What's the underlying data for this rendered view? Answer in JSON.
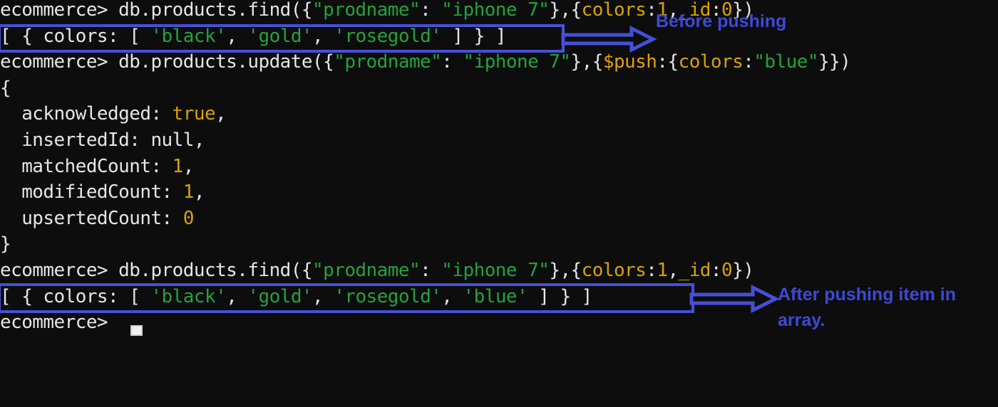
{
  "terminal": {
    "background_color": "#0d0d0d",
    "prompt": "ecommerce>",
    "lines": [
      {
        "id": "line-find-before",
        "segments": [
          {
            "text": "ecommerce> db.products.find(",
            "color": "white"
          },
          {
            "text": "{",
            "color": "white"
          },
          {
            "text": "\"prodname\"",
            "color": "green"
          },
          {
            "text": ": ",
            "color": "white"
          },
          {
            "text": "\"iphone 7\"",
            "color": "green"
          },
          {
            "text": "},{",
            "color": "white"
          },
          {
            "text": "colors",
            "color": "yellow"
          },
          {
            "text": ":",
            "color": "white"
          },
          {
            "text": "1",
            "color": "yellow"
          },
          {
            "text": ",",
            "color": "white"
          },
          {
            "text": "_id",
            "color": "yellow"
          },
          {
            "text": ":",
            "color": "white"
          },
          {
            "text": "0",
            "color": "yellow"
          },
          {
            "text": "})",
            "color": "white"
          }
        ]
      },
      {
        "id": "line-result-before",
        "segments": [
          {
            "text": "[ { colors: [ ",
            "color": "white"
          },
          {
            "text": "'black'",
            "color": "green"
          },
          {
            "text": ", ",
            "color": "white"
          },
          {
            "text": "'gold'",
            "color": "green"
          },
          {
            "text": ", ",
            "color": "white"
          },
          {
            "text": "'rosegold'",
            "color": "green"
          },
          {
            "text": " ] } ]",
            "color": "white"
          }
        ]
      },
      {
        "id": "line-update",
        "segments": [
          {
            "text": "ecommerce> db.products.update(",
            "color": "white"
          },
          {
            "text": "{",
            "color": "white"
          },
          {
            "text": "\"prodname\"",
            "color": "green"
          },
          {
            "text": ": ",
            "color": "white"
          },
          {
            "text": "\"iphone 7\"",
            "color": "green"
          },
          {
            "text": "},{",
            "color": "white"
          },
          {
            "text": "$push",
            "color": "orange"
          },
          {
            "text": ":{",
            "color": "white"
          },
          {
            "text": "colors",
            "color": "yellow"
          },
          {
            "text": ":",
            "color": "white"
          },
          {
            "text": "\"blue\"",
            "color": "green"
          },
          {
            "text": "}})",
            "color": "white"
          }
        ]
      },
      {
        "id": "line-open-brace",
        "segments": [
          {
            "text": "{",
            "color": "white"
          }
        ]
      },
      {
        "id": "line-acknowledged",
        "segments": [
          {
            "text": "  acknowledged: ",
            "color": "white"
          },
          {
            "text": "true",
            "color": "yellow"
          },
          {
            "text": ",",
            "color": "white"
          }
        ]
      },
      {
        "id": "line-insertedid",
        "segments": [
          {
            "text": "  insertedId: null,",
            "color": "white"
          }
        ]
      },
      {
        "id": "line-matchedcount",
        "segments": [
          {
            "text": "  matchedCount: ",
            "color": "white"
          },
          {
            "text": "1",
            "color": "yellow"
          },
          {
            "text": ",",
            "color": "white"
          }
        ]
      },
      {
        "id": "line-modifiedcount",
        "segments": [
          {
            "text": "  modifiedCount: ",
            "color": "white"
          },
          {
            "text": "1",
            "color": "yellow"
          },
          {
            "text": ",",
            "color": "white"
          }
        ]
      },
      {
        "id": "line-upsertedcount",
        "segments": [
          {
            "text": "  upsertedCount: ",
            "color": "white"
          },
          {
            "text": "0",
            "color": "yellow"
          }
        ]
      },
      {
        "id": "line-close-brace",
        "segments": [
          {
            "text": "}",
            "color": "white"
          }
        ]
      },
      {
        "id": "line-find-after",
        "segments": [
          {
            "text": "ecommerce> db.products.find(",
            "color": "white"
          },
          {
            "text": "{",
            "color": "white"
          },
          {
            "text": "\"prodname\"",
            "color": "green"
          },
          {
            "text": ": ",
            "color": "white"
          },
          {
            "text": "\"iphone 7\"",
            "color": "green"
          },
          {
            "text": "},{",
            "color": "white"
          },
          {
            "text": "colors",
            "color": "yellow"
          },
          {
            "text": ":",
            "color": "white"
          },
          {
            "text": "1",
            "color": "yellow"
          },
          {
            "text": ",",
            "color": "white"
          },
          {
            "text": "_id",
            "color": "yellow"
          },
          {
            "text": ":",
            "color": "white"
          },
          {
            "text": "0",
            "color": "yellow"
          },
          {
            "text": "})",
            "color": "white"
          }
        ]
      },
      {
        "id": "line-result-after",
        "segments": [
          {
            "text": "[ { colors: [ ",
            "color": "white"
          },
          {
            "text": "'black'",
            "color": "green"
          },
          {
            "text": ", ",
            "color": "white"
          },
          {
            "text": "'gold'",
            "color": "green"
          },
          {
            "text": ", ",
            "color": "white"
          },
          {
            "text": "'rosegold'",
            "color": "green"
          },
          {
            "text": ", ",
            "color": "white"
          },
          {
            "text": "'blue'",
            "color": "green"
          },
          {
            "text": " ] } ]",
            "color": "white"
          }
        ]
      },
      {
        "id": "line-prompt-final",
        "segments": [
          {
            "text": "ecommerce> ",
            "color": "white"
          }
        ]
      }
    ]
  },
  "annotations": {
    "accent_color": "#4550d8",
    "items": [
      {
        "id": "before-pushing",
        "label": "Before pushing",
        "icon": "right-arrow-icon"
      },
      {
        "id": "after-pushing",
        "label": "After pushing item in\narray.",
        "icon": "right-arrow-icon"
      }
    ]
  },
  "query_data": {
    "database": "ecommerce",
    "collection": "products",
    "filter_field": "prodname",
    "filter_value": "iphone 7",
    "projection": "{colors:1,_id:0}",
    "operator": "$push",
    "pushed_field": "colors",
    "pushed_value": "blue",
    "colors_before": [
      "black",
      "gold",
      "rosegold"
    ],
    "colors_after": [
      "black",
      "gold",
      "rosegold",
      "blue"
    ],
    "update_result": {
      "acknowledged": "true",
      "insertedId": "null",
      "matchedCount": "1",
      "modifiedCount": "1",
      "upsertedCount": "0"
    }
  },
  "cursor": {
    "style": "hollow-block"
  }
}
